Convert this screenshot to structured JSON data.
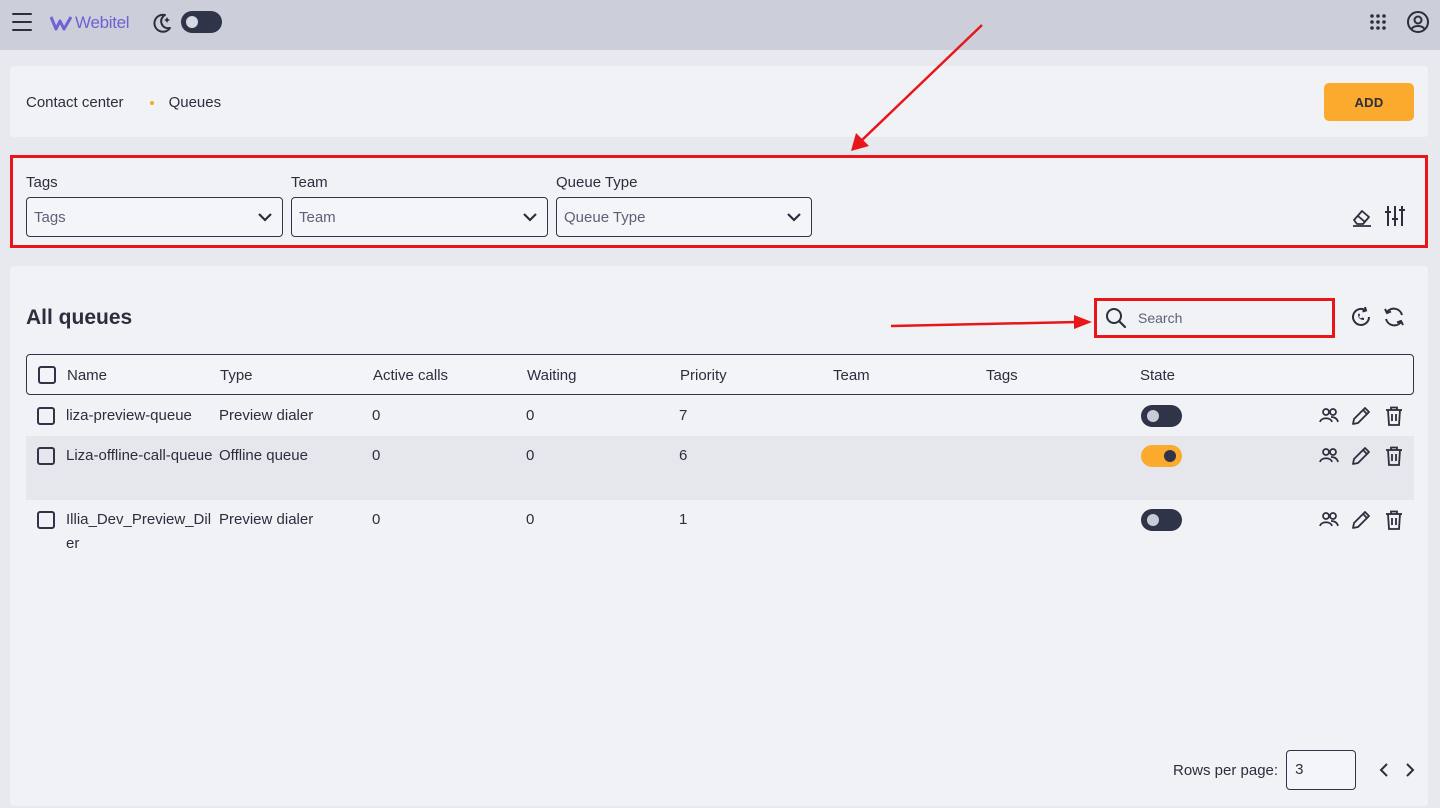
{
  "topbar": {
    "logo_text": "Webitel",
    "icons": [
      "menu-icon",
      "moon-icon",
      "apps-grid-icon",
      "account-icon"
    ]
  },
  "header": {
    "breadcrumb": [
      "Contact center",
      "Queues"
    ],
    "add_label": "ADD"
  },
  "filters": {
    "tags": {
      "label": "Tags",
      "placeholder": "Tags"
    },
    "team": {
      "label": "Team",
      "placeholder": "Team"
    },
    "queue_type": {
      "label": "Queue Type",
      "placeholder": "Queue Type"
    }
  },
  "table": {
    "title": "All queues",
    "search_placeholder": "Search",
    "columns": [
      "Name",
      "Type",
      "Active calls",
      "Waiting",
      "Priority",
      "Team",
      "Tags",
      "State"
    ],
    "rows": [
      {
        "name": "liza-preview-queue",
        "type": "Preview dialer",
        "active_calls": "0",
        "waiting": "0",
        "priority": "7",
        "team": "",
        "tags": "",
        "state_on": false
      },
      {
        "name": "Liza-offline-call-queue",
        "type": "Offline queue",
        "active_calls": "0",
        "waiting": "0",
        "priority": "6",
        "team": "",
        "tags": "",
        "state_on": true
      },
      {
        "name": "Illia_Dev_Preview_Diler",
        "type": "Preview dialer",
        "active_calls": "0",
        "waiting": "0",
        "priority": "1",
        "team": "",
        "tags": "",
        "state_on": false
      }
    ]
  },
  "pagination": {
    "rows_per_page_label": "Rows per page:",
    "rows_per_page_value": "3"
  },
  "colors": {
    "accent": "#fbaa2d",
    "annotation": "#e8161a",
    "dark": "#2f3448"
  }
}
